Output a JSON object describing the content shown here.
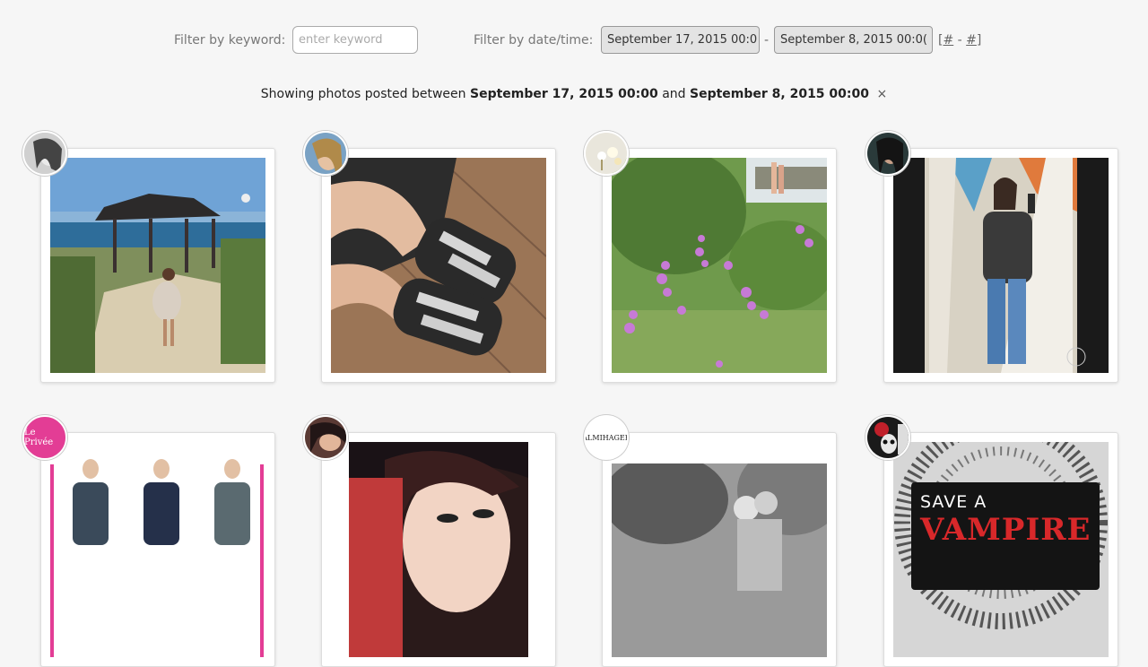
{
  "filters": {
    "keyword_label": "Filter by keyword:",
    "keyword_placeholder": "enter keyword",
    "date_label": "Filter by date/time:",
    "date_start": "September 17, 2015 00:0",
    "date_end": "September 8, 2015 00:0(",
    "date_separator": "-",
    "hash_open": "[",
    "hash_start": "#",
    "hash_sep": " - ",
    "hash_end": "#",
    "hash_close": "]"
  },
  "summary": {
    "prefix": "Showing photos posted between",
    "start": "September 17, 2015 00:00",
    "conjunction": "and",
    "end": "September 8, 2015 00:00",
    "clear_icon": "×"
  },
  "posts": [
    {
      "name": "post-1",
      "avatar_label": ""
    },
    {
      "name": "post-2",
      "avatar_label": ""
    },
    {
      "name": "post-3",
      "avatar_label": ""
    },
    {
      "name": "post-4",
      "avatar_label": ""
    },
    {
      "name": "post-5",
      "avatar_label": "Le Privée"
    },
    {
      "name": "post-6",
      "avatar_label": ""
    },
    {
      "name": "post-7",
      "avatar_label": "ALMIHAGER"
    },
    {
      "name": "post-8",
      "avatar_label": ""
    }
  ],
  "photo_texts": {
    "vampire_line1": "SAVE A",
    "vampire_line2": "VAMPIRE"
  },
  "colors": {
    "accent_pink": "#e33d95",
    "background": "#f6f6f6"
  }
}
